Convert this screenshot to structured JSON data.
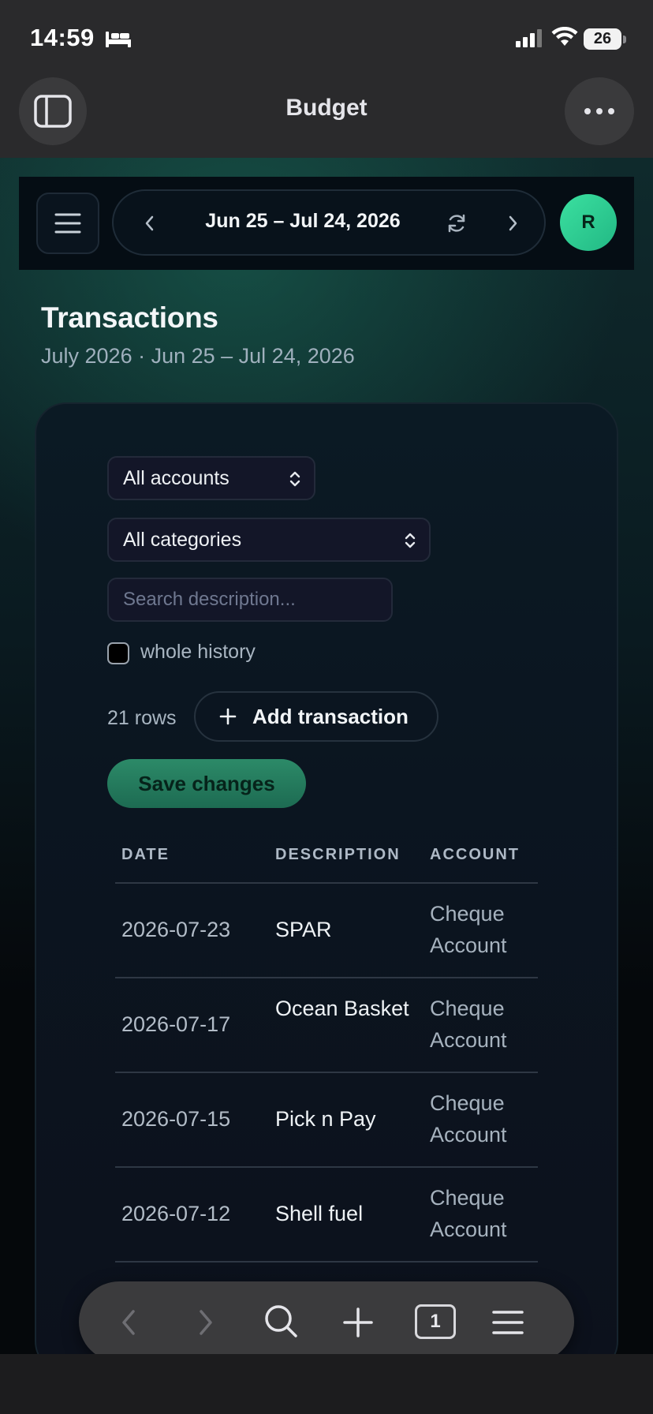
{
  "status_bar": {
    "time": "14:59",
    "battery": "26",
    "icons": [
      "bed-icon",
      "signal-icon",
      "wifi-icon",
      "battery-icon"
    ]
  },
  "browser": {
    "title": "Budget",
    "tabs_count": "1",
    "icons": [
      "sidebar-icon",
      "more-icon",
      "back-icon",
      "forward-icon",
      "search-icon",
      "plus-icon",
      "tabs-icon",
      "menu-icon"
    ]
  },
  "app_bar": {
    "range_label": "Jun 25 – Jul 24, 2026",
    "avatar_initial": "R",
    "icons": [
      "hamburger-icon",
      "chevron-left-icon",
      "refresh-icon",
      "chevron-right-icon"
    ]
  },
  "header": {
    "title": "Transactions",
    "subtitle": "July 2026 · Jun 25 – Jul 24, 2026"
  },
  "filters": {
    "account_select": "All accounts",
    "category_select": "All categories",
    "search_placeholder": "Search description...",
    "whole_history_label": "whole history",
    "whole_history_checked": false
  },
  "actions": {
    "row_count": "21 rows",
    "add_label": "Add transaction",
    "save_label": "Save changes"
  },
  "table": {
    "columns": [
      "DATE",
      "DESCRIPTION",
      "ACCOUNT"
    ],
    "rows": [
      {
        "date": "2026-07-23",
        "description": "SPAR",
        "account": "Cheque Account"
      },
      {
        "date": "2026-07-17",
        "description": "Ocean Basket",
        "account": "Cheque Account"
      },
      {
        "date": "2026-07-15",
        "description": "Pick n Pay",
        "account": "Cheque Account"
      },
      {
        "date": "2026-07-12",
        "description": "Shell fuel",
        "account": "Cheque Account"
      }
    ]
  },
  "colors": {
    "accent": "#2aa37a",
    "avatar": "#34d399",
    "page_bg": "#05080b"
  }
}
